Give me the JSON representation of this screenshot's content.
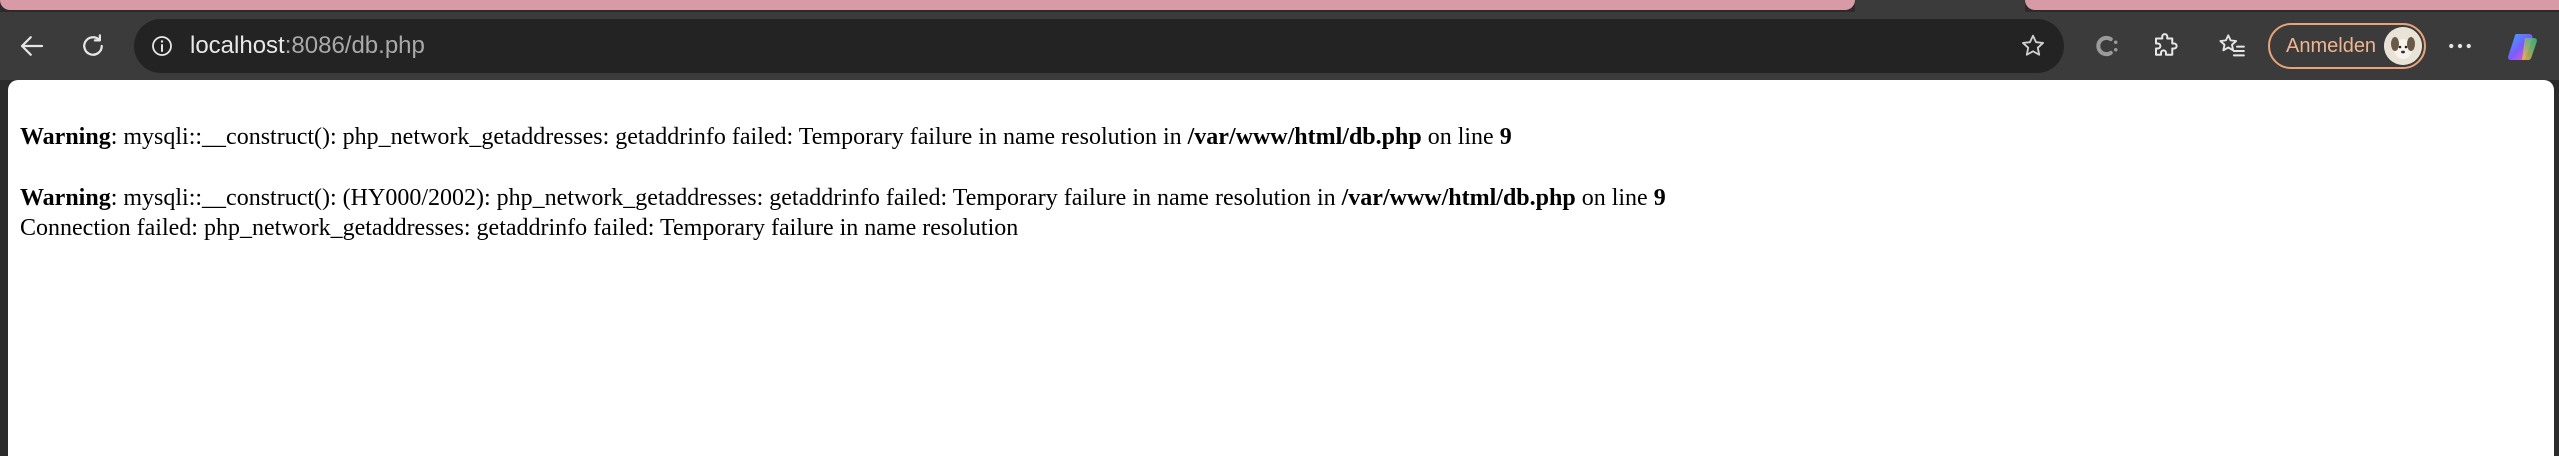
{
  "browser": {
    "url_host": "localhost",
    "url_rest": ":8086/db.php",
    "signin_label": "Anmelden",
    "accent": "#e8a27a",
    "icons": [
      "back-arrow-icon",
      "reload-icon",
      "info-icon",
      "star-icon",
      "c-extension-icon",
      "puzzle-icon",
      "favorites-icon",
      "more-icon",
      "copilot-icon"
    ]
  },
  "page": {
    "warning1": {
      "label": "Warning",
      "text": ": mysqli::__construct(): php_network_getaddresses: getaddrinfo failed: Temporary failure in name resolution in ",
      "file": "/var/www/html/db.php",
      "on_line": " on line ",
      "line_no": "9"
    },
    "warning2": {
      "label": "Warning",
      "text": ": mysqli::__construct(): (HY000/2002): php_network_getaddresses: getaddrinfo failed: Temporary failure in name resolution in ",
      "file": "/var/www/html/db.php",
      "on_line": " on line ",
      "line_no": "9"
    },
    "connection_error": "Connection failed: php_network_getaddresses: getaddrinfo failed: Temporary failure in name resolution"
  }
}
